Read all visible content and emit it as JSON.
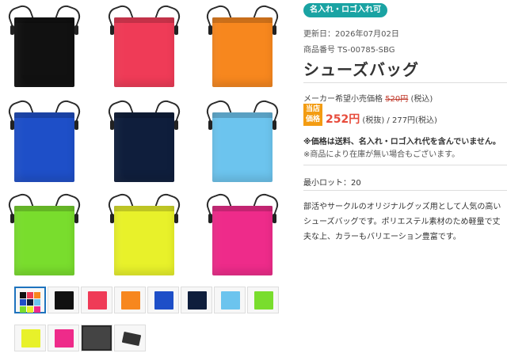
{
  "badge": "名入れ・ロゴ入れ可",
  "updated": "更新日：2026年07月02日",
  "product_code": "商品番号 TS-00785-SBG",
  "title": "シューズバッグ",
  "maker_label": "メーカー希望小売価格",
  "maker_price": "520円",
  "maker_tax": "(税込)",
  "sale_badge": "当店価格",
  "sale_price": "252円",
  "sale_tax_ex": "(税抜)",
  "sale_sep": " / ",
  "sale_price_inc": "277円(税込)",
  "note_bold": "※価格は送料、名入れ・ロゴ入れ代を含んでいません。",
  "note_stock": "※商品により在庫が無い場合もございます。",
  "min_lot": "最小ロット：20",
  "description": "部活やサークルのオリジナルグッズ用として人気の高いシューズバッグです。ポリエステル素材のため軽量で丈夫な上、カラーもバリエーション豊富です。",
  "colors": {
    "black": "#111111",
    "red": "#ef3b57",
    "orange": "#f7871e",
    "blue": "#1e4fc8",
    "navy": "#0f1e3c",
    "skyblue": "#6cc4ee",
    "lime": "#79dd2d",
    "yellow": "#e8f12a",
    "pink": "#ee2b8a",
    "accent": "#1aa3a3"
  },
  "thumb_icons": [
    "color-grid",
    "black",
    "red",
    "orange",
    "blue",
    "navy",
    "skyblue",
    "lime",
    "yellow",
    "pink",
    "dark-detail",
    "bag-detail"
  ]
}
